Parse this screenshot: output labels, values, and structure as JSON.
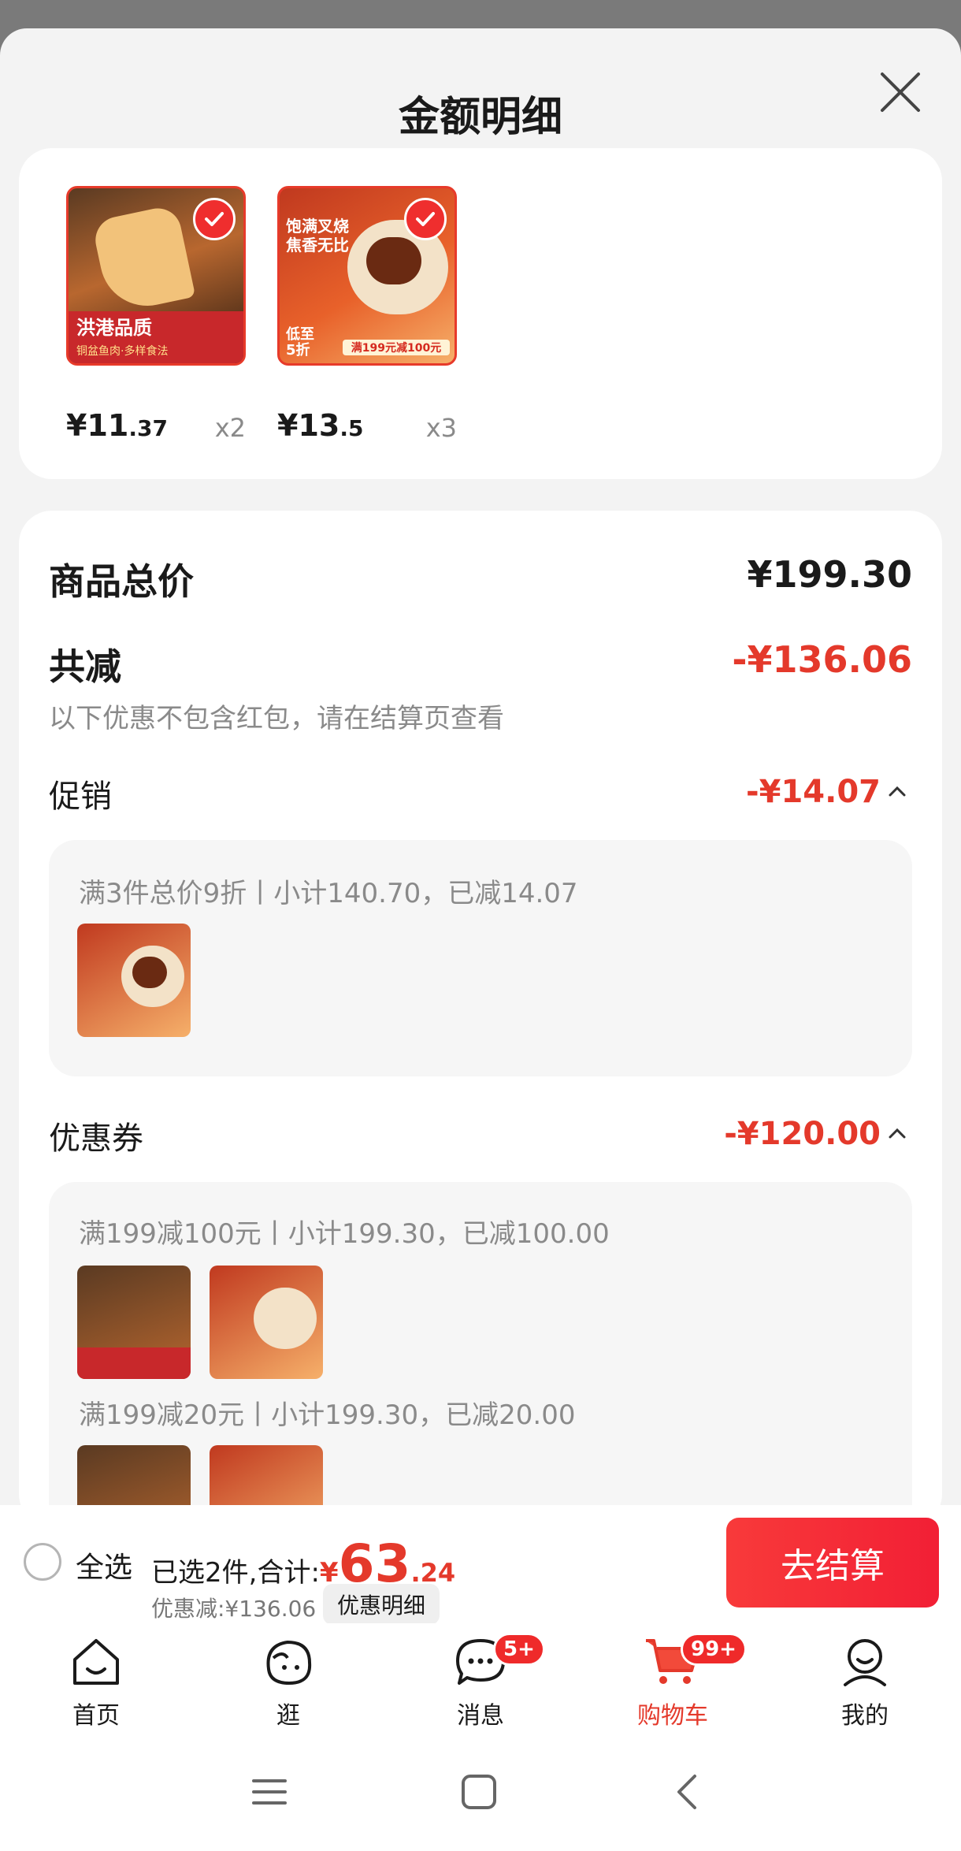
{
  "sheet": {
    "title": "金额明细"
  },
  "goods": [
    {
      "price_main": "¥11",
      "price_cents": ".37",
      "qty": "x2",
      "thumb_lines": [
        "洪港品质",
        "铜盆鱼肉·多样食法"
      ]
    },
    {
      "price_main": "¥13",
      "price_cents": ".5",
      "qty": "x3",
      "thumb_lines": [
        "饱满叉烧",
        "焦香无比",
        "低至",
        "5折",
        "满199元减100元"
      ]
    }
  ],
  "detail": {
    "total_label": "商品总价",
    "total_value": "¥199.30",
    "discount_label": "共减",
    "discount_value": "-¥136.06",
    "note": "以下优惠不包含红包，请在结算页查看",
    "promo": {
      "label": "促销",
      "value": "-¥14.07",
      "rule": "满3件总价9折丨小计140.70，已减14.07"
    },
    "coupon": {
      "label": "优惠券",
      "value": "-¥120.00",
      "rule1": "满199减100元丨小计199.30，已减100.00",
      "rule2": "满199减20元丨小计199.30，已减20.00"
    }
  },
  "bottom_bar": {
    "select_all": "全选",
    "summary_prefix": "已选2件,合计:",
    "currency": "¥",
    "total_main": "63",
    "total_cents": ".24",
    "saved": "优惠减:¥136.06",
    "detail_chip": "优惠明细",
    "checkout": "去结算"
  },
  "tabs": [
    {
      "label": "首页",
      "icon": "home-icon"
    },
    {
      "label": "逛",
      "icon": "browse-icon"
    },
    {
      "label": "消息",
      "icon": "message-icon",
      "badge": "5+"
    },
    {
      "label": "购物车",
      "icon": "cart-icon",
      "badge": "99+",
      "active": true
    },
    {
      "label": "我的",
      "icon": "profile-icon"
    }
  ],
  "colors": {
    "accent": "#e4392b",
    "checkout_bg": "#f21f35"
  }
}
